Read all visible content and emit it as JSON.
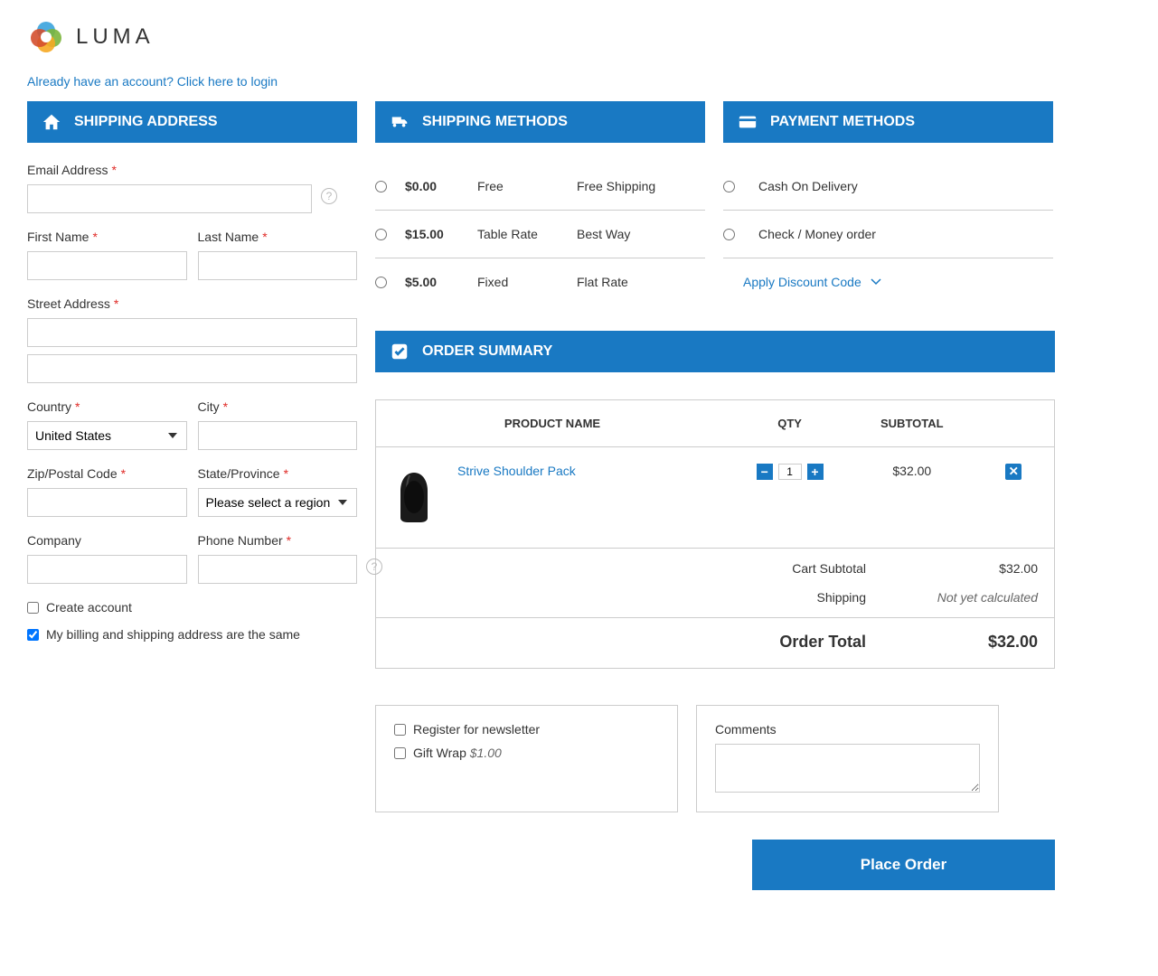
{
  "brand": "LUMA",
  "login_prompt": "Already have an account? Click here to login",
  "sections": {
    "shipping_address": "Shipping Address",
    "shipping_methods": "Shipping Methods",
    "payment_methods": "Payment Methods",
    "order_summary": "Order Summary"
  },
  "fields": {
    "email": "Email Address",
    "first_name": "First Name",
    "last_name": "Last Name",
    "street": "Street Address",
    "country": "Country",
    "city": "City",
    "zip": "Zip/Postal Code",
    "state": "State/Province",
    "company": "Company",
    "phone": "Phone Number",
    "country_value": "United States",
    "state_placeholder": "Please select a region",
    "create_account": "Create account",
    "same_billing": "My billing and shipping address are the same"
  },
  "shipping_methods": [
    {
      "price": "$0.00",
      "carrier": "Free",
      "name": "Free Shipping"
    },
    {
      "price": "$15.00",
      "carrier": "Table Rate",
      "name": "Best Way"
    },
    {
      "price": "$5.00",
      "carrier": "Fixed",
      "name": "Flat Rate"
    }
  ],
  "payment_methods": [
    {
      "label": "Cash On Delivery"
    },
    {
      "label": "Check / Money order"
    }
  ],
  "discount_label": "Apply Discount Code",
  "summary": {
    "cols": {
      "product": "PRODUCT NAME",
      "qty": "QTY",
      "subtotal": "SUBTOTAL"
    },
    "items": [
      {
        "name": "Strive Shoulder Pack",
        "qty": "1",
        "subtotal": "$32.00"
      }
    ],
    "cart_subtotal_label": "Cart Subtotal",
    "cart_subtotal": "$32.00",
    "shipping_label": "Shipping",
    "shipping_value": "Not yet calculated",
    "order_total_label": "Order Total",
    "order_total": "$32.00"
  },
  "extras": {
    "newsletter": "Register for newsletter",
    "giftwrap": "Gift Wrap",
    "giftwrap_price": "$1.00",
    "comments": "Comments"
  },
  "place_order": "Place Order"
}
